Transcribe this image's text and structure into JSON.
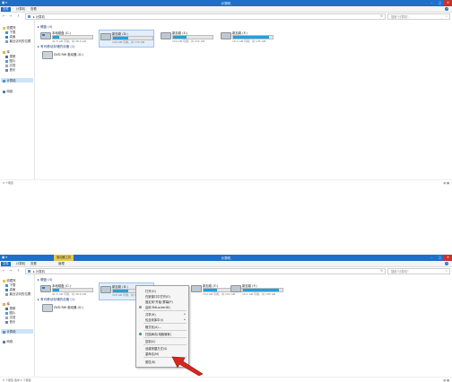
{
  "window": {
    "title": "计算机",
    "qat": "▣ ▾",
    "buttons": {
      "minimize": "–",
      "maximize": "□",
      "close": "✕"
    }
  },
  "ribbon": {
    "tabs": [
      "文件",
      "计算机",
      "查看"
    ],
    "tabs_bottom": [
      "文件",
      "计算机",
      "查看",
      "管理"
    ],
    "context_tab": "驱动器工具",
    "help": "?"
  },
  "address": {
    "back": "←",
    "forward": "→",
    "up": "↑",
    "path": "▸ 计算机",
    "refresh": "↻",
    "search_placeholder": "搜索\"计算机\"",
    "search_icon": "⌕"
  },
  "nav": {
    "items": [
      "收藏夹",
      "下载",
      "桌面",
      "最近访问的位置",
      "库",
      "视频",
      "图片",
      "文档",
      "音乐",
      "计算机",
      "网络"
    ]
  },
  "content": {
    "group_drives": "▸ 硬盘 (4)",
    "group_removable": "▸ 有可移动存储的设备 (1)",
    "drives": [
      {
        "name": "本地磁盘 (C:)",
        "size": "41.5 GB 可用，共 48.9 GB",
        "usage": 0.15
      },
      {
        "name": "新加卷 (D:)",
        "size": "109 GB 可用，共 179 GB",
        "usage": 0.39
      },
      {
        "name": "新加卷 (E:)",
        "size": "154 GB 可用，共 232 GB",
        "usage": 0.34
      },
      {
        "name": "新加卷 (F:)",
        "size": "16.1 GB 可用，共 195 GB",
        "usage": 0.92
      }
    ],
    "dvd": {
      "name": "DVD RW 驱动器 (G:)"
    }
  },
  "status": {
    "count": "5 个项目",
    "selected": "5 个项目  选中 1 个项目",
    "views": "▤ ▦"
  },
  "context_menu": {
    "items": [
      {
        "label": "打开(O)"
      },
      {
        "label": "在新窗口中打开(E)"
      },
      {
        "label": "固定到\"开始\"屏幕(P)"
      },
      {
        "label": "启用 BitLocker(B)",
        "icon": true
      },
      {
        "label": "共享(H)",
        "arrow": "▸"
      },
      {
        "label": "包含到库中(I)",
        "arrow": "▸"
      },
      {
        "label": "格式化(A)..."
      },
      {
        "label": "扫描病毒(电脑管家)",
        "icon": true
      },
      {
        "label": "复制(C)"
      },
      {
        "label": "创建快捷方式(S)"
      },
      {
        "label": "重命名(M)"
      },
      {
        "label": "属性(R)"
      }
    ]
  },
  "colors": {
    "accent": "#1e6fc8",
    "bar_fill": "#26a0da",
    "arrow": "#d8261c",
    "selected": "#cce4f7"
  }
}
